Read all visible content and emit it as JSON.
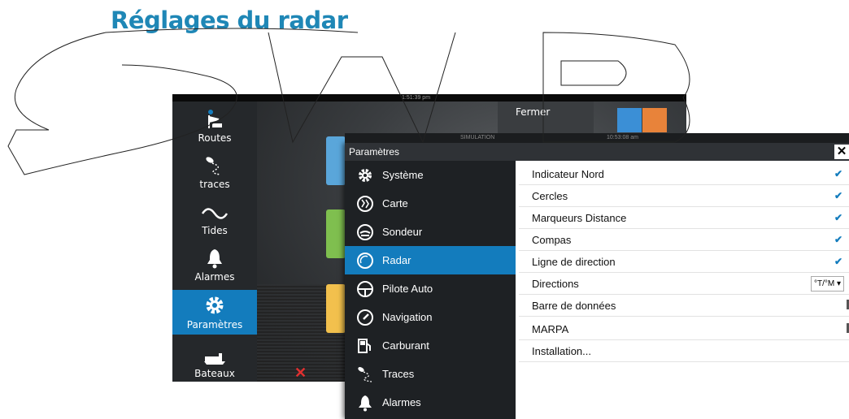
{
  "page_heading": "Réglages du radar",
  "device": {
    "status_time": "1:51:39 pm",
    "fermer_label": "Fermer",
    "side_nav": [
      {
        "label": "Routes",
        "icon": "routes-icon"
      },
      {
        "label": "traces",
        "icon": "trail-icon"
      },
      {
        "label": "Tides",
        "icon": "wave-icon"
      },
      {
        "label": "Alarmes",
        "icon": "bell-icon"
      },
      {
        "label": "Paramètres",
        "icon": "gear-icon",
        "active": true
      },
      {
        "label": "Bateaux",
        "icon": "boat-icon"
      }
    ]
  },
  "dialog": {
    "sim_label": "SIMULATION",
    "clock": "10:53:08 am",
    "title": "Paramètres",
    "menu": [
      {
        "label": "Système",
        "icon": "gear-icon"
      },
      {
        "label": "Carte",
        "icon": "chart-icon"
      },
      {
        "label": "Sondeur",
        "icon": "sounder-icon"
      },
      {
        "label": "Radar",
        "icon": "radar-icon",
        "active": true
      },
      {
        "label": "Pilote Auto",
        "icon": "steering-wheel-icon"
      },
      {
        "label": "Navigation",
        "icon": "compass-icon"
      },
      {
        "label": "Carburant",
        "icon": "fuel-pump-icon"
      },
      {
        "label": "Traces",
        "icon": "trail-icon"
      },
      {
        "label": "Alarmes",
        "icon": "bell-icon"
      }
    ],
    "options": [
      {
        "label": "Indicateur Nord",
        "control": "checkbox",
        "checked": true
      },
      {
        "label": "Cercles",
        "control": "checkbox",
        "checked": true
      },
      {
        "label": "Marqueurs Distance",
        "control": "checkbox",
        "checked": true
      },
      {
        "label": "Compas",
        "control": "checkbox",
        "checked": true
      },
      {
        "label": "Ligne de direction",
        "control": "checkbox",
        "checked": true
      },
      {
        "label": "Directions",
        "control": "select",
        "value": "°T/°M"
      },
      {
        "label": "Barre de données",
        "control": "toggle"
      },
      {
        "label": "MARPA",
        "control": "toggle"
      },
      {
        "label": "Installation...",
        "control": "none"
      }
    ]
  },
  "colors": {
    "accent": "#137cbd",
    "heading": "#1f87b6"
  }
}
